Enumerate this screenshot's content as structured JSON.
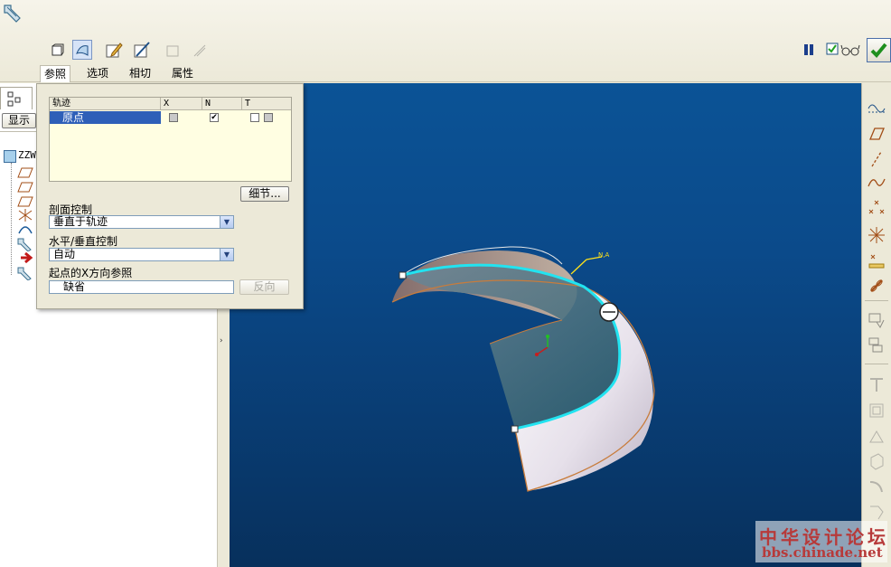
{
  "tabs": [
    {
      "label": "参照",
      "active": true
    },
    {
      "label": "选项"
    },
    {
      "label": "相切"
    },
    {
      "label": "属性"
    }
  ],
  "tree": {
    "show_button": "显示",
    "root_label": "ZZW"
  },
  "references": {
    "columns": [
      "轨迹",
      "X",
      "N",
      "T"
    ],
    "rows": [
      {
        "name": "原点",
        "x_checked": false,
        "n_checked": true,
        "t_checked": false
      }
    ],
    "details_button": "细节..."
  },
  "section_control": {
    "label": "剖面控制",
    "value": "垂直于轨迹"
  },
  "hv_control": {
    "label": "水平/垂直控制",
    "value": "自动"
  },
  "start_x_ref": {
    "label": "起点的X方向参照",
    "value": "缺省",
    "flip_button": "反向"
  },
  "viewport": {
    "annotation": "N,A"
  },
  "watermark": {
    "title": "中华设计论坛",
    "url": "bbs.chinade.net"
  },
  "colors": {
    "accent": "#2e5fb8",
    "trajectory": "#22e3f0",
    "surface_edge": "#c87c3c",
    "watermark": "#b73a3a"
  }
}
